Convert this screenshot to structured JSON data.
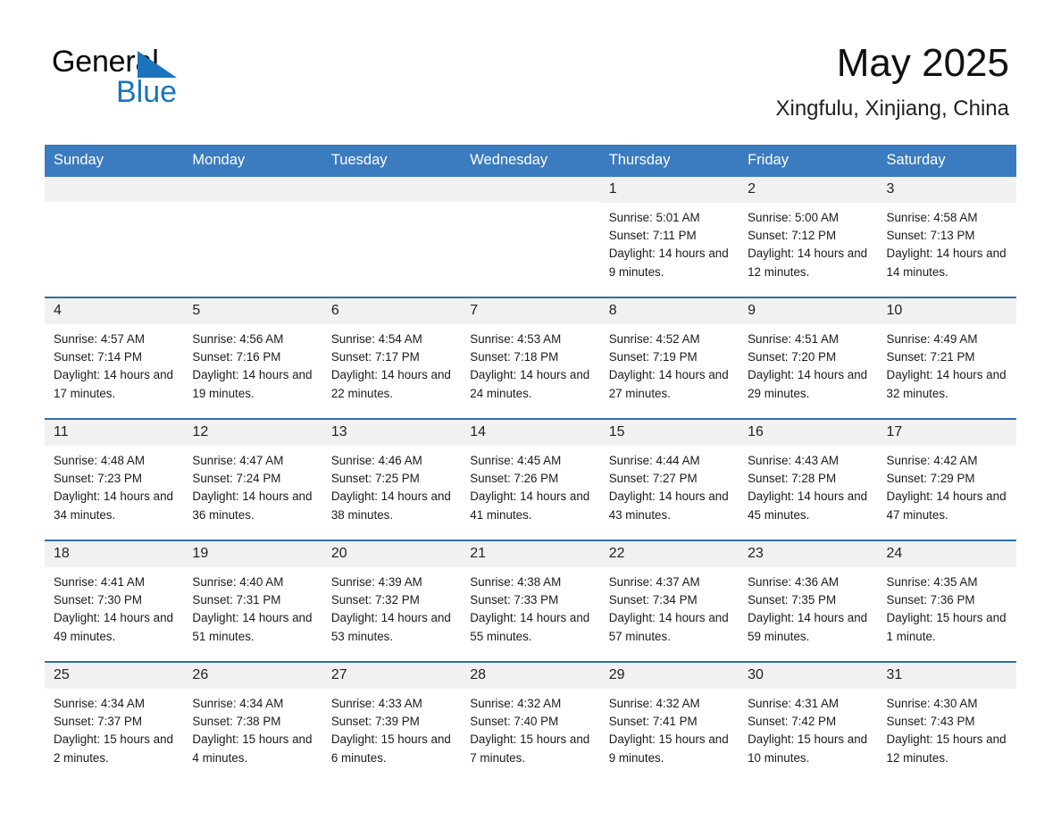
{
  "logo": {
    "word_one": "General",
    "word_two": "Blue",
    "triangle_color": "#1b74bb",
    "icon": "triangle-icon"
  },
  "header": {
    "title": "May 2025",
    "location": "Xingfulu, Xinjiang, China"
  },
  "theme": {
    "header_bg": "#3b7bbf",
    "header_text": "#ffffff",
    "row_divider": "#2f6fae",
    "daynum_bg": "#f1f1f1",
    "cell_bg": "#ffffff"
  },
  "weekdays": [
    "Sunday",
    "Monday",
    "Tuesday",
    "Wednesday",
    "Thursday",
    "Friday",
    "Saturday"
  ],
  "weeks": [
    [
      {
        "day": "",
        "empty": true
      },
      {
        "day": "",
        "empty": true
      },
      {
        "day": "",
        "empty": true
      },
      {
        "day": "",
        "empty": true
      },
      {
        "day": "1",
        "sunrise": "Sunrise: 5:01 AM",
        "sunset": "Sunset: 7:11 PM",
        "daylight": "Daylight: 14 hours and 9 minutes."
      },
      {
        "day": "2",
        "sunrise": "Sunrise: 5:00 AM",
        "sunset": "Sunset: 7:12 PM",
        "daylight": "Daylight: 14 hours and 12 minutes."
      },
      {
        "day": "3",
        "sunrise": "Sunrise: 4:58 AM",
        "sunset": "Sunset: 7:13 PM",
        "daylight": "Daylight: 14 hours and 14 minutes."
      }
    ],
    [
      {
        "day": "4",
        "sunrise": "Sunrise: 4:57 AM",
        "sunset": "Sunset: 7:14 PM",
        "daylight": "Daylight: 14 hours and 17 minutes."
      },
      {
        "day": "5",
        "sunrise": "Sunrise: 4:56 AM",
        "sunset": "Sunset: 7:16 PM",
        "daylight": "Daylight: 14 hours and 19 minutes."
      },
      {
        "day": "6",
        "sunrise": "Sunrise: 4:54 AM",
        "sunset": "Sunset: 7:17 PM",
        "daylight": "Daylight: 14 hours and 22 minutes."
      },
      {
        "day": "7",
        "sunrise": "Sunrise: 4:53 AM",
        "sunset": "Sunset: 7:18 PM",
        "daylight": "Daylight: 14 hours and 24 minutes."
      },
      {
        "day": "8",
        "sunrise": "Sunrise: 4:52 AM",
        "sunset": "Sunset: 7:19 PM",
        "daylight": "Daylight: 14 hours and 27 minutes."
      },
      {
        "day": "9",
        "sunrise": "Sunrise: 4:51 AM",
        "sunset": "Sunset: 7:20 PM",
        "daylight": "Daylight: 14 hours and 29 minutes."
      },
      {
        "day": "10",
        "sunrise": "Sunrise: 4:49 AM",
        "sunset": "Sunset: 7:21 PM",
        "daylight": "Daylight: 14 hours and 32 minutes."
      }
    ],
    [
      {
        "day": "11",
        "sunrise": "Sunrise: 4:48 AM",
        "sunset": "Sunset: 7:23 PM",
        "daylight": "Daylight: 14 hours and 34 minutes."
      },
      {
        "day": "12",
        "sunrise": "Sunrise: 4:47 AM",
        "sunset": "Sunset: 7:24 PM",
        "daylight": "Daylight: 14 hours and 36 minutes."
      },
      {
        "day": "13",
        "sunrise": "Sunrise: 4:46 AM",
        "sunset": "Sunset: 7:25 PM",
        "daylight": "Daylight: 14 hours and 38 minutes."
      },
      {
        "day": "14",
        "sunrise": "Sunrise: 4:45 AM",
        "sunset": "Sunset: 7:26 PM",
        "daylight": "Daylight: 14 hours and 41 minutes."
      },
      {
        "day": "15",
        "sunrise": "Sunrise: 4:44 AM",
        "sunset": "Sunset: 7:27 PM",
        "daylight": "Daylight: 14 hours and 43 minutes."
      },
      {
        "day": "16",
        "sunrise": "Sunrise: 4:43 AM",
        "sunset": "Sunset: 7:28 PM",
        "daylight": "Daylight: 14 hours and 45 minutes."
      },
      {
        "day": "17",
        "sunrise": "Sunrise: 4:42 AM",
        "sunset": "Sunset: 7:29 PM",
        "daylight": "Daylight: 14 hours and 47 minutes."
      }
    ],
    [
      {
        "day": "18",
        "sunrise": "Sunrise: 4:41 AM",
        "sunset": "Sunset: 7:30 PM",
        "daylight": "Daylight: 14 hours and 49 minutes."
      },
      {
        "day": "19",
        "sunrise": "Sunrise: 4:40 AM",
        "sunset": "Sunset: 7:31 PM",
        "daylight": "Daylight: 14 hours and 51 minutes."
      },
      {
        "day": "20",
        "sunrise": "Sunrise: 4:39 AM",
        "sunset": "Sunset: 7:32 PM",
        "daylight": "Daylight: 14 hours and 53 minutes."
      },
      {
        "day": "21",
        "sunrise": "Sunrise: 4:38 AM",
        "sunset": "Sunset: 7:33 PM",
        "daylight": "Daylight: 14 hours and 55 minutes."
      },
      {
        "day": "22",
        "sunrise": "Sunrise: 4:37 AM",
        "sunset": "Sunset: 7:34 PM",
        "daylight": "Daylight: 14 hours and 57 minutes."
      },
      {
        "day": "23",
        "sunrise": "Sunrise: 4:36 AM",
        "sunset": "Sunset: 7:35 PM",
        "daylight": "Daylight: 14 hours and 59 minutes."
      },
      {
        "day": "24",
        "sunrise": "Sunrise: 4:35 AM",
        "sunset": "Sunset: 7:36 PM",
        "daylight": "Daylight: 15 hours and 1 minute."
      }
    ],
    [
      {
        "day": "25",
        "sunrise": "Sunrise: 4:34 AM",
        "sunset": "Sunset: 7:37 PM",
        "daylight": "Daylight: 15 hours and 2 minutes."
      },
      {
        "day": "26",
        "sunrise": "Sunrise: 4:34 AM",
        "sunset": "Sunset: 7:38 PM",
        "daylight": "Daylight: 15 hours and 4 minutes."
      },
      {
        "day": "27",
        "sunrise": "Sunrise: 4:33 AM",
        "sunset": "Sunset: 7:39 PM",
        "daylight": "Daylight: 15 hours and 6 minutes."
      },
      {
        "day": "28",
        "sunrise": "Sunrise: 4:32 AM",
        "sunset": "Sunset: 7:40 PM",
        "daylight": "Daylight: 15 hours and 7 minutes."
      },
      {
        "day": "29",
        "sunrise": "Sunrise: 4:32 AM",
        "sunset": "Sunset: 7:41 PM",
        "daylight": "Daylight: 15 hours and 9 minutes."
      },
      {
        "day": "30",
        "sunrise": "Sunrise: 4:31 AM",
        "sunset": "Sunset: 7:42 PM",
        "daylight": "Daylight: 15 hours and 10 minutes."
      },
      {
        "day": "31",
        "sunrise": "Sunrise: 4:30 AM",
        "sunset": "Sunset: 7:43 PM",
        "daylight": "Daylight: 15 hours and 12 minutes."
      }
    ]
  ]
}
